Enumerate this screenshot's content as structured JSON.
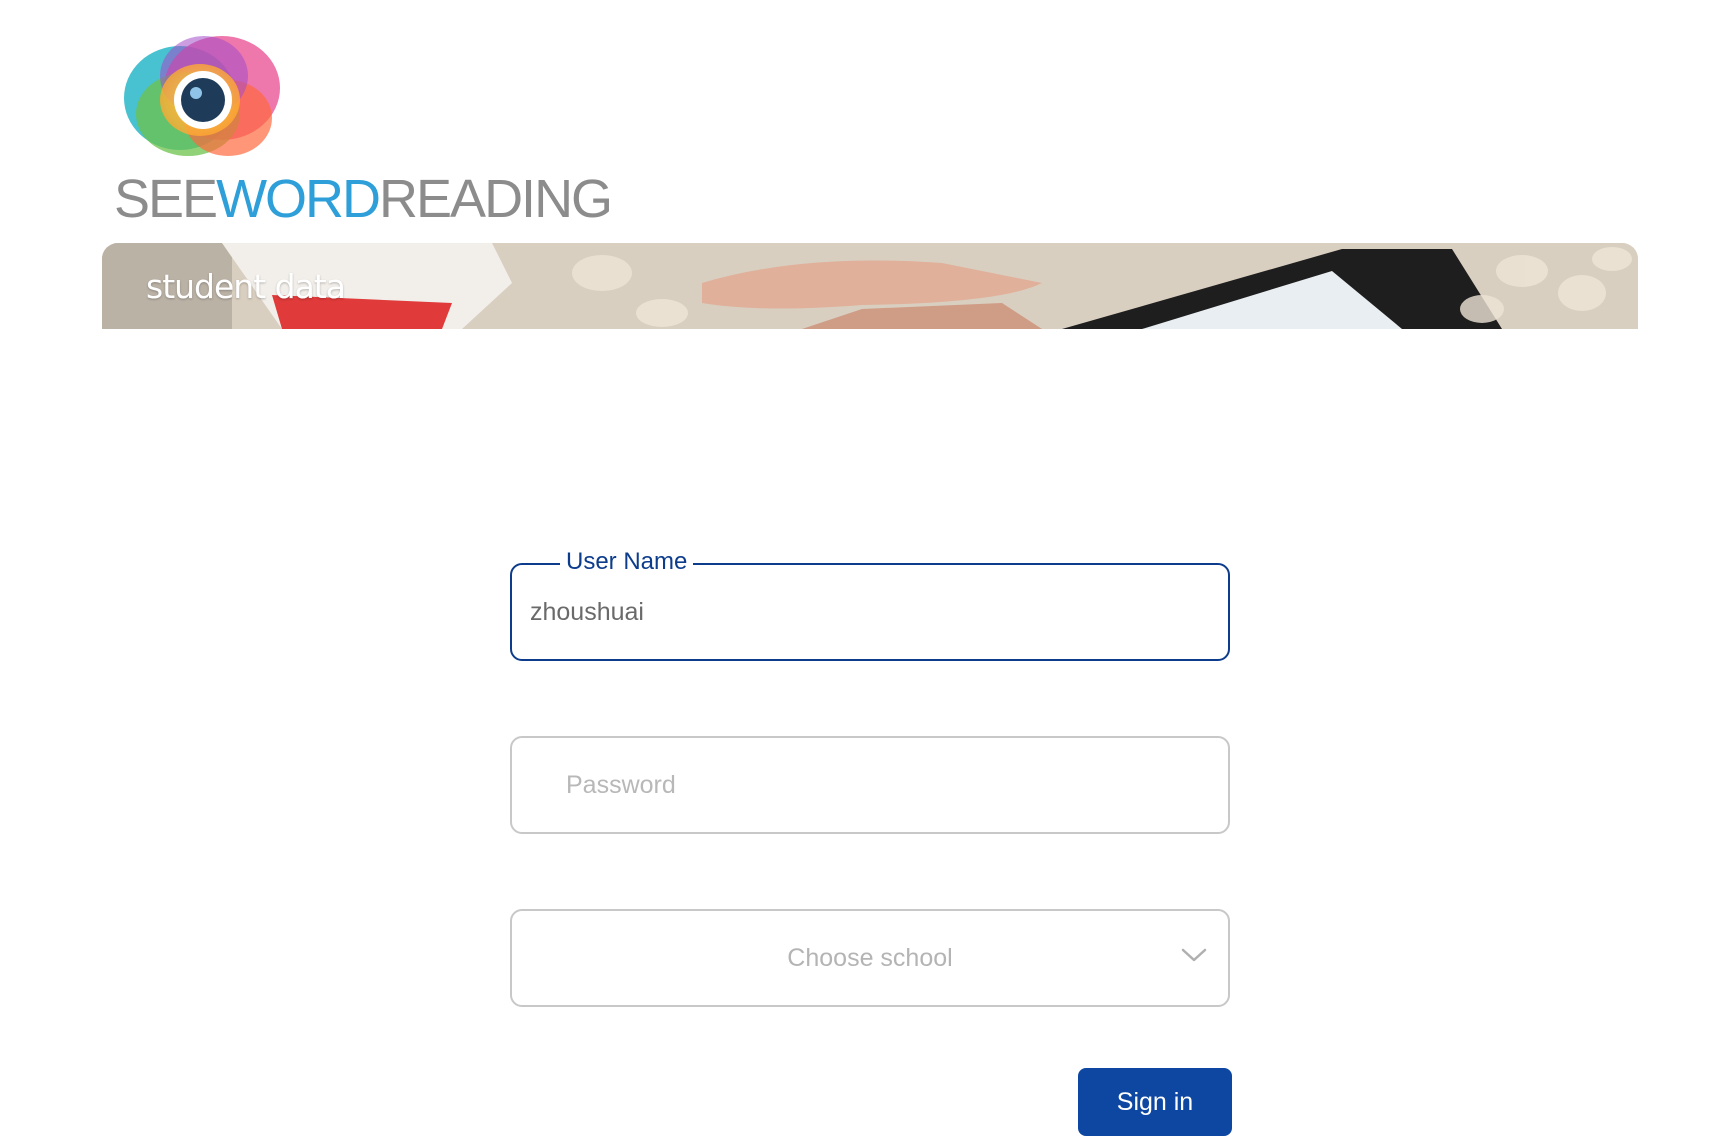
{
  "brand": {
    "logo_text_see": "SEE",
    "logo_text_word": "WORD",
    "logo_text_reading": "READING",
    "logo_icon": "eye-icon",
    "word_color": "#2e9fd8",
    "gray_color": "#8c8c8c"
  },
  "banner": {
    "title": "student data"
  },
  "form": {
    "username": {
      "label": "User Name",
      "value": "zhoushuai"
    },
    "password": {
      "placeholder": "Password",
      "value": ""
    },
    "school": {
      "placeholder": "Choose school",
      "icon": "chevron-down-icon"
    },
    "signin_label": "Sign in",
    "accent_color": "#0d47a1"
  }
}
